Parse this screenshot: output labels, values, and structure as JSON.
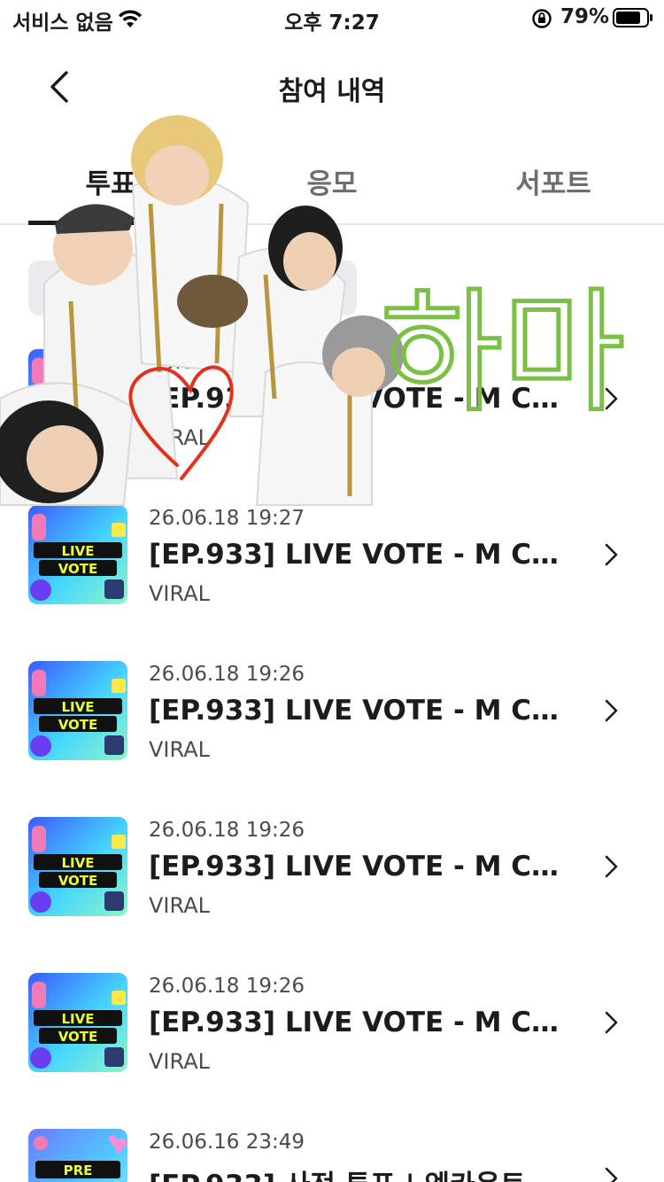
{
  "status_bar": {
    "carrier": "서비스 없음",
    "time": "오후 7:27",
    "battery_percent": "79%"
  },
  "header": {
    "title": "참여 내역",
    "back_icon": "chevron-left-icon"
  },
  "tabs": [
    {
      "label": "투표",
      "active": true
    },
    {
      "label": "응모",
      "active": false
    },
    {
      "label": "서포트",
      "active": false
    }
  ],
  "filter": {
    "label": "ㅈ"
  },
  "list": [
    {
      "date": "26.06.18 19:27",
      "title": "[EP.933] LIVE VOTE - M COU...",
      "category": "VIRAL",
      "thumb": "live-vote"
    },
    {
      "date": "26.06.18 19:27",
      "title": "[EP.933] LIVE VOTE - M COU...",
      "category": "VIRAL",
      "thumb": "live-vote"
    },
    {
      "date": "26.06.18 19:26",
      "title": "[EP.933] LIVE VOTE - M COU...",
      "category": "VIRAL",
      "thumb": "live-vote"
    },
    {
      "date": "26.06.18 19:26",
      "title": "[EP.933] LIVE VOTE - M COU...",
      "category": "VIRAL",
      "thumb": "live-vote"
    },
    {
      "date": "26.06.18 19:26",
      "title": "[EP.933] LIVE VOTE - M COU...",
      "category": "VIRAL",
      "thumb": "live-vote"
    },
    {
      "date": "26.06.16 23:49",
      "title": "[EP.933] 사전 투표 | 엠카운트다운",
      "category": "",
      "thumb": "pre-vote"
    }
  ],
  "thumbs": {
    "live_line1": "LIVE",
    "live_line2": "VOTE",
    "pre_line1": "PRE"
  },
  "sticker": {
    "handwriting": "하마",
    "handwriting_color": "#7ac143",
    "heart_color": "#e0321c"
  },
  "colors": {
    "text": "#1c1c1e",
    "secondary": "#4a4a4f",
    "divider": "#e5e5ea"
  }
}
